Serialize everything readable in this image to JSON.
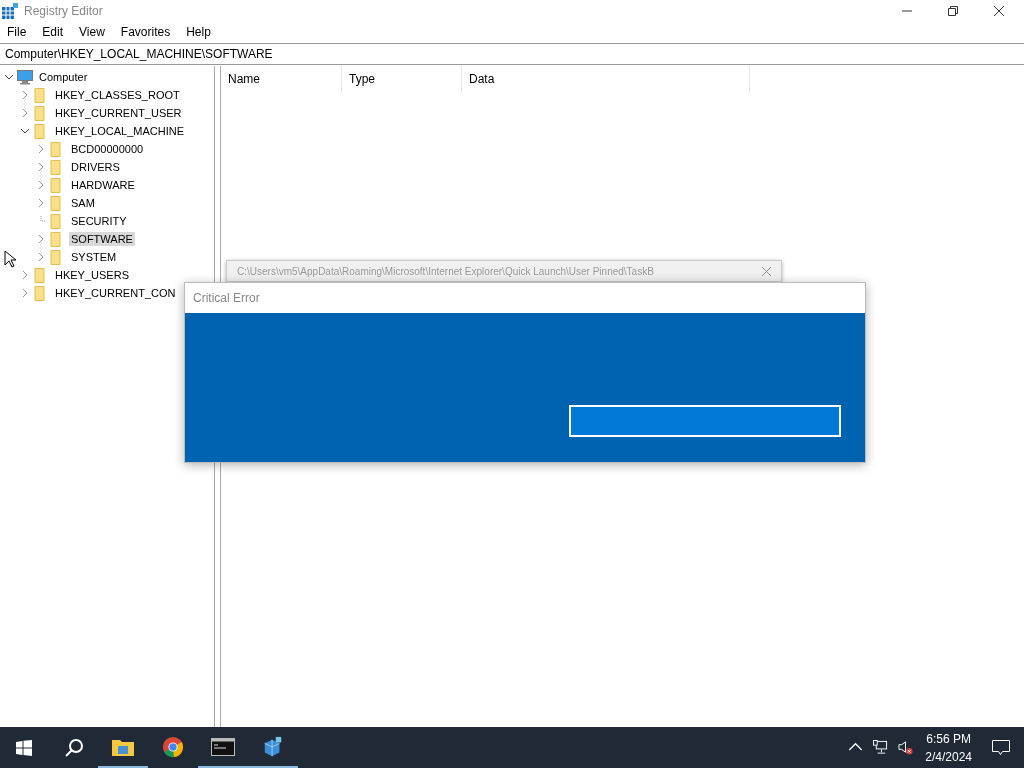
{
  "window": {
    "title": "Registry Editor"
  },
  "menu": [
    "File",
    "Edit",
    "View",
    "Favorites",
    "Help"
  ],
  "address": "Computer\\HKEY_LOCAL_MACHINE\\SOFTWARE",
  "tree": {
    "label": "Computer",
    "kind": "computer",
    "expandable": true,
    "expanded": true,
    "selected": false,
    "children": [
      {
        "label": "HKEY_CLASSES_ROOT",
        "kind": "folder",
        "expandable": true,
        "expanded": false,
        "selected": false
      },
      {
        "label": "HKEY_CURRENT_USER",
        "kind": "folder",
        "expandable": true,
        "expanded": false,
        "selected": false
      },
      {
        "label": "HKEY_LOCAL_MACHINE",
        "kind": "folder",
        "expandable": true,
        "expanded": true,
        "selected": false,
        "children": [
          {
            "label": "BCD00000000",
            "kind": "folder",
            "expandable": true,
            "expanded": false,
            "selected": false
          },
          {
            "label": "DRIVERS",
            "kind": "folder",
            "expandable": true,
            "expanded": false,
            "selected": false
          },
          {
            "label": "HARDWARE",
            "kind": "folder",
            "expandable": true,
            "expanded": false,
            "selected": false
          },
          {
            "label": "SAM",
            "kind": "folder",
            "expandable": true,
            "expanded": false,
            "selected": false
          },
          {
            "label": "SECURITY",
            "kind": "folder",
            "expandable": false,
            "selected": false
          },
          {
            "label": "SOFTWARE",
            "kind": "folder",
            "expandable": true,
            "expanded": false,
            "selected": true
          },
          {
            "label": "SYSTEM",
            "kind": "folder",
            "expandable": true,
            "expanded": false,
            "selected": false
          }
        ]
      },
      {
        "label": "HKEY_USERS",
        "kind": "folder",
        "expandable": true,
        "expanded": false,
        "selected": false
      },
      {
        "label": "HKEY_CURRENT_CON",
        "kind": "folder",
        "expandable": true,
        "expanded": false,
        "selected": false
      }
    ]
  },
  "columns": [
    "Name",
    "Type",
    "Data"
  ],
  "back_window": {
    "title": "C:\\Users\\vm5\\AppData\\Roaming\\Microsoft\\Internet Explorer\\Quick Launch\\User Pinned\\TaskB"
  },
  "dialog": {
    "title": "Critical Error"
  },
  "taskbar": {
    "apps": [
      {
        "kind": "explorer",
        "running": true
      },
      {
        "kind": "chrome",
        "running": false
      },
      {
        "kind": "cmd",
        "running": true
      },
      {
        "kind": "regedit",
        "running": true
      }
    ],
    "time": "6:56 PM",
    "date": "2/4/2024"
  }
}
